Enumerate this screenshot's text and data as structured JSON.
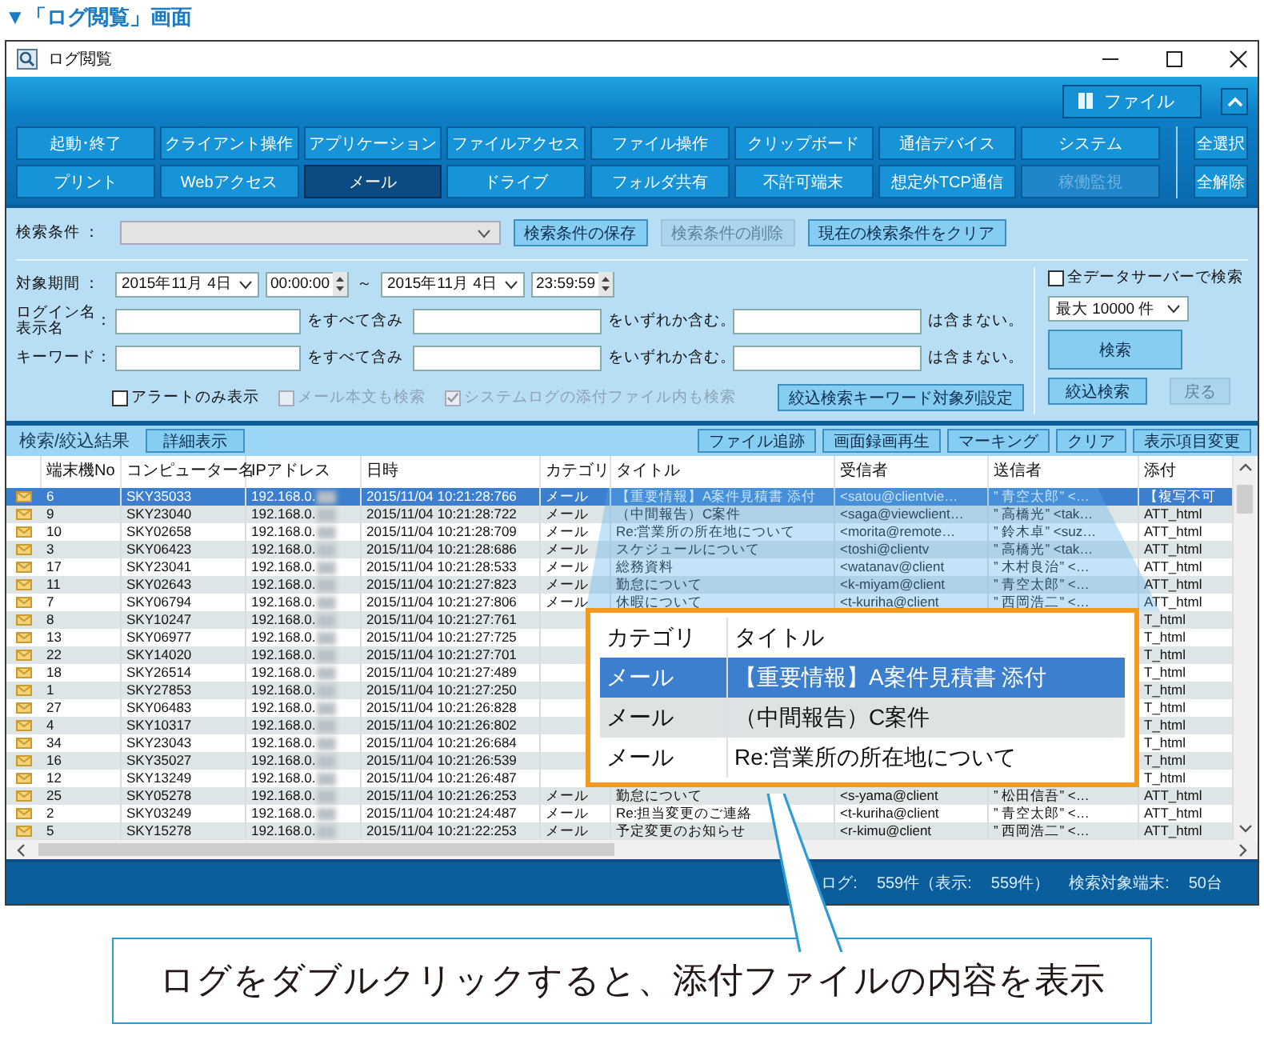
{
  "heading": "▼「ログ閲覧」画面",
  "window": {
    "title": "ログ閲覧"
  },
  "ribbon": {
    "file_button": "ファイル",
    "categories": [
      {
        "label": "起動･終了",
        "selected": false,
        "disabled": false
      },
      {
        "label": "クライアント操作",
        "selected": false,
        "disabled": false
      },
      {
        "label": "アプリケーション",
        "selected": false,
        "disabled": false
      },
      {
        "label": "ファイルアクセス",
        "selected": false,
        "disabled": false
      },
      {
        "label": "ファイル操作",
        "selected": false,
        "disabled": false
      },
      {
        "label": "クリップボード",
        "selected": false,
        "disabled": false
      },
      {
        "label": "通信デバイス",
        "selected": false,
        "disabled": false
      },
      {
        "label": "システム",
        "selected": false,
        "disabled": false
      },
      {
        "label": "プリント",
        "selected": false,
        "disabled": false
      },
      {
        "label": "Webアクセス",
        "selected": false,
        "disabled": false
      },
      {
        "label": "メール",
        "selected": true,
        "disabled": false
      },
      {
        "label": "ドライブ",
        "selected": false,
        "disabled": false
      },
      {
        "label": "フォルダ共有",
        "selected": false,
        "disabled": false
      },
      {
        "label": "不許可端末",
        "selected": false,
        "disabled": false
      },
      {
        "label": "想定外TCP通信",
        "selected": false,
        "disabled": false
      },
      {
        "label": "稼働監視",
        "selected": false,
        "disabled": true
      }
    ],
    "select_all": "全選択",
    "deselect_all": "全解除"
  },
  "search": {
    "condition_label": "検索条件 ：",
    "condition_dropdown": {
      "disabled": true
    },
    "buttons": [
      {
        "label": "検索条件の保存",
        "disabled": false
      },
      {
        "label": "検索条件の削除",
        "disabled": true
      },
      {
        "label": "現在の検索条件をクリア",
        "disabled": false
      }
    ],
    "period_label": "対象期間 ：",
    "date_from": "2015年11月 4日",
    "time_from": "00:00:00",
    "tilde": "～",
    "date_to": "2015年11月 4日",
    "time_to": "23:59:59",
    "filter_rows": [
      {
        "label_lines": [
          "ログイン名",
          "表示名"
        ],
        "colon": "：",
        "all": "をすべて含み",
        "any": "をいずれか含む。",
        "none": "は含まない。"
      },
      {
        "label_lines": [
          "キーワード"
        ],
        "colon": "：",
        "all": "をすべて含み",
        "any": "をいずれか含む。",
        "none": "は含まない。"
      }
    ],
    "options": [
      {
        "label": "アラートのみ表示",
        "checked": false,
        "disabled": false
      },
      {
        "label": "メール本文も検索",
        "checked": false,
        "disabled": true
      },
      {
        "label": "システムログの添付ファイル内も検索",
        "checked": true,
        "disabled": true
      }
    ],
    "column_setting_button": "絞込検索キーワード対象列設定",
    "all_servers": {
      "label": "全データサーバーで検索",
      "checked": false
    },
    "max_select": "最大 10000 件",
    "search_button": "検索",
    "narrow_button": "絞込検索",
    "back_button": {
      "label": "戻る",
      "disabled": true
    }
  },
  "results": {
    "title": "検索/絞込結果",
    "detail_button": "詳細表示",
    "actions": [
      "ファイル追跡",
      "画面録画再生",
      "マーキング",
      "クリア",
      "表示項目変更"
    ],
    "columns": [
      "端末機No",
      "コンピューター名",
      "IPアドレス",
      "日時",
      "カテゴリ",
      "タイトル",
      "受信者",
      "送信者",
      "添付"
    ],
    "rows": [
      {
        "no": "6",
        "computer": "SKY35033",
        "ip": "192.168.0.",
        "datetime": "2015/11/04 10:21:28:766",
        "category": "メール",
        "title": "【重要情報】A案件見積書 添付",
        "recipient": "<satou@clientvie…",
        "sender": "” 青空太郎” <…",
        "attachment": "【複写不可",
        "selected": true
      },
      {
        "no": "9",
        "computer": "SKY23040",
        "ip": "192.168.0.",
        "datetime": "2015/11/04 10:21:28:722",
        "category": "メール",
        "title": "（中間報告）C案件",
        "recipient": "<saga@viewclient…",
        "sender": "” 高橋光” <tak…",
        "attachment": "ATT_html",
        "selected": false
      },
      {
        "no": "10",
        "computer": "SKY02658",
        "ip": "192.168.0.",
        "datetime": "2015/11/04 10:21:28:709",
        "category": "メール",
        "title": "Re:営業所の所在地について",
        "recipient": "<morita@remote…",
        "sender": "” 鈴木卓” <suz…",
        "attachment": "ATT_html",
        "selected": false
      },
      {
        "no": "3",
        "computer": "SKY06423",
        "ip": "192.168.0.",
        "datetime": "2015/11/04 10:21:28:686",
        "category": "メール",
        "title": "スケジュールについて",
        "recipient": "<toshi@clientv",
        "sender": "” 高橋光” <tak…",
        "attachment": "ATT_html",
        "selected": false
      },
      {
        "no": "17",
        "computer": "SKY23041",
        "ip": "192.168.0.",
        "datetime": "2015/11/04 10:21:28:533",
        "category": "メール",
        "title": "総務資料",
        "recipient": "<watanav@client",
        "sender": "” 木村良治” <…",
        "attachment": "ATT_html",
        "selected": false
      },
      {
        "no": "11",
        "computer": "SKY02643",
        "ip": "192.168.0.",
        "datetime": "2015/11/04 10:21:27:823",
        "category": "メール",
        "title": "勤怠について",
        "recipient": "<k-miyam@client",
        "sender": "” 青空太郎” <…",
        "attachment": "ATT_html",
        "selected": false
      },
      {
        "no": "7",
        "computer": "SKY06794",
        "ip": "192.168.0.",
        "datetime": "2015/11/04 10:21:27:806",
        "category": "メール",
        "title": "休暇について",
        "recipient": "<t-kuriha@client",
        "sender": "” 西岡浩二” <…",
        "attachment": "ATT_html",
        "selected": false
      },
      {
        "no": "8",
        "computer": "SKY10247",
        "ip": "192.168.0.",
        "datetime": "2015/11/04 10:21:27:761",
        "attachment": "T_html",
        "selected": false
      },
      {
        "no": "13",
        "computer": "SKY06977",
        "ip": "192.168.0.",
        "datetime": "2015/11/04 10:21:27:725",
        "attachment": "T_html",
        "selected": false
      },
      {
        "no": "22",
        "computer": "SKY14020",
        "ip": "192.168.0.",
        "datetime": "2015/11/04 10:21:27:701",
        "attachment": "T_html",
        "selected": false
      },
      {
        "no": "18",
        "computer": "SKY26514",
        "ip": "192.168.0.",
        "datetime": "2015/11/04 10:21:27:489",
        "attachment": "T_html",
        "selected": false
      },
      {
        "no": "1",
        "computer": "SKY27853",
        "ip": "192.168.0.",
        "datetime": "2015/11/04 10:21:27:250",
        "attachment": "T_html",
        "selected": false
      },
      {
        "no": "27",
        "computer": "SKY06483",
        "ip": "192.168.0.",
        "datetime": "2015/11/04 10:21:26:828",
        "attachment": "T_html",
        "selected": false
      },
      {
        "no": "4",
        "computer": "SKY10317",
        "ip": "192.168.0.",
        "datetime": "2015/11/04 10:21:26:802",
        "attachment": "T_html",
        "selected": false
      },
      {
        "no": "34",
        "computer": "SKY23043",
        "ip": "192.168.0.",
        "datetime": "2015/11/04 10:21:26:684",
        "attachment": "T_html",
        "selected": false
      },
      {
        "no": "16",
        "computer": "SKY35027",
        "ip": "192.168.0.",
        "datetime": "2015/11/04 10:21:26:539",
        "attachment": "T_html",
        "selected": false
      },
      {
        "no": "12",
        "computer": "SKY13249",
        "ip": "192.168.0.",
        "datetime": "2015/11/04 10:21:26:487",
        "attachment": "T_html",
        "selected": false
      },
      {
        "no": "25",
        "computer": "SKY05278",
        "ip": "192.168.0.",
        "datetime": "2015/11/04 10:21:26:253",
        "category": "メール",
        "title": "勤怠について",
        "recipient": "<s-yama@client",
        "sender": "” 松田信吾” <…",
        "attachment": "ATT_html",
        "selected": false
      },
      {
        "no": "2",
        "computer": "SKY03249",
        "ip": "192.168.0.",
        "datetime": "2015/11/04 10:21:24:487",
        "category": "メール",
        "title": "Re:担当変更のご連絡",
        "recipient": "<t-kuriha@client",
        "sender": "” 青空太郎” <…",
        "attachment": "ATT_html",
        "selected": false
      },
      {
        "no": "5",
        "computer": "SKY15278",
        "ip": "192.168.0.",
        "datetime": "2015/11/04 10:21:22:253",
        "category": "メール",
        "title": "予定変更のお知らせ",
        "recipient": "<r-kimu@client",
        "sender": "” 西岡浩二” <…",
        "attachment": "ATT_html",
        "selected": false
      }
    ]
  },
  "zoom_callout": {
    "columns": [
      "カテゴリ",
      "タイトル"
    ],
    "rows": [
      {
        "category": "メール",
        "title": "【重要情報】A案件見積書 添付",
        "selected": true
      },
      {
        "category": "メール",
        "title": "（中間報告）C案件",
        "selected": false
      },
      {
        "category": "メール",
        "title": "Re:営業所の所在地について",
        "selected": false
      }
    ]
  },
  "status_bar": [
    "ログ:",
    "559件（表示:",
    "559件）",
    "検索対象端末:",
    "50台"
  ],
  "note": "ログをダブルクリックすると、添付ファイルの内容を表示"
}
